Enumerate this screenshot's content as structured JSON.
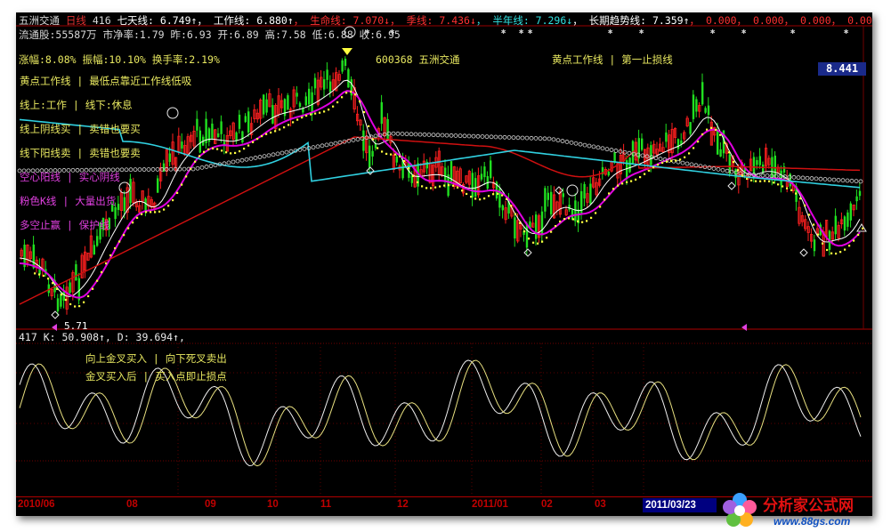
{
  "header": {
    "line1": [
      {
        "text": "五洲交通",
        "color": "#d8d8d8"
      },
      {
        "text": " 日线 ",
        "color": "#e03030"
      },
      {
        "text": " 416 ",
        "color": "#d8d8d8"
      },
      {
        "text": "七天线: 6.749↑",
        "color": "#ffffff"
      },
      {
        "text": "， 工作线: 6.880↑",
        "color": "#ffffff"
      },
      {
        "text": "， 生命线: 7.070↓",
        "color": "#ff3030"
      },
      {
        "text": "， 季线: 7.436↓",
        "color": "#ff3030"
      },
      {
        "text": "， 半年线: 7.296↓",
        "color": "#30e0e0"
      },
      {
        "text": "， 长期趋势线: 7.359↑",
        "color": "#ffffff"
      },
      {
        "text": "， 0.000， 0.000， 0.000， 0.000， 0.000， 0.000",
        "color": "#ff3030"
      }
    ],
    "line2": "流通股:55587万 市净率:1.79 昨:6.93 开:6.89 高:7.58 低:6.88 收:6.95",
    "line3": "涨幅:8.08% 振幅:10.10% 换手率:2.19%",
    "stock": "600368 五洲交通",
    "legend_right": "黄点工作线   |  第一止损线"
  },
  "legend_left": [
    {
      "text": "黄点工作线    |  最低点靠近工作线低吸",
      "color": "#e8e860"
    },
    {
      "text": "线上:工作   |   线下:休息",
      "color": "#e8e860"
    },
    {
      "text": "线上阴线买  |  卖错也要买",
      "color": "#e8e860"
    },
    {
      "text": "线下阳线卖  |  卖错也要卖",
      "color": "#e8e860"
    },
    {
      "text": "空心阳线    |  实心阴线",
      "color": "#e040e0"
    },
    {
      "text": "粉色K线     |  大量出货",
      "color": "#e040e0"
    },
    {
      "text": "多空止赢    |  保护线",
      "color": "#e040e0"
    }
  ],
  "price_box": "8.441",
  "low_label": "5.71",
  "kd": {
    "header": "417  K: 50.908↑, D: 39.694↑,",
    "legend": [
      "向上金叉买入  |  向下死叉卖出",
      "金叉买入后   |  买入点即止损点"
    ]
  },
  "dates": [
    "2010/06",
    "08",
    "09",
    "10",
    "11",
    "12",
    "2011/01",
    "02",
    "03"
  ],
  "current_date": "2011/03/23",
  "logo": {
    "title": "分析家公式网",
    "url": "www.88gs.com"
  },
  "colors": {
    "up": "#ff2020",
    "down": "#20e020",
    "work": "#ffffff",
    "life": "#e000e0",
    "season": "#d01010",
    "halfyear": "#30d0e0",
    "longterm": "#d0d0d0",
    "dots": "#ffff40"
  }
}
